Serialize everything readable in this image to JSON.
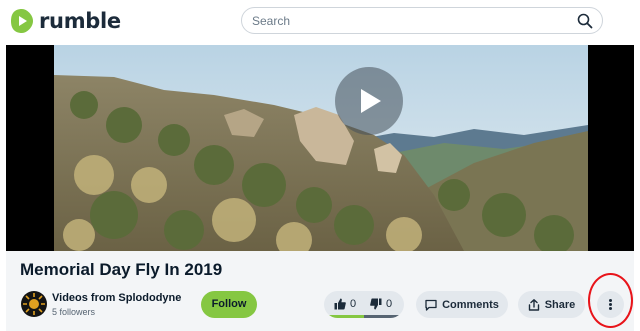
{
  "header": {
    "logo_text": "rumble",
    "search_placeholder": "Search"
  },
  "colors": {
    "brand_green": "#85c742",
    "highlight_red": "#e8141a",
    "button_gray": "#e3e8ed"
  },
  "video": {
    "title": "Memorial Day Fly In 2019",
    "channel_name": "Videos from Splododyne",
    "followers": "5 followers",
    "follow_label": "Follow",
    "likes": "0",
    "dislikes": "0",
    "comments_label": "Comments",
    "share_label": "Share"
  },
  "icons": [
    "play-icon",
    "search-icon",
    "thumbs-up-icon",
    "thumbs-down-icon",
    "comment-icon",
    "share-icon",
    "more-vertical-icon"
  ]
}
